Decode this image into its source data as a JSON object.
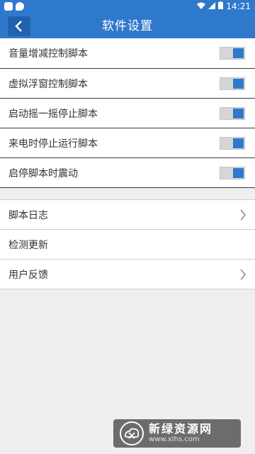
{
  "status_bar": {
    "time": "14:21",
    "icons": [
      "app-icon-1",
      "app-icon-2",
      "wifi-icon",
      "signal-icon",
      "battery-icon"
    ]
  },
  "header": {
    "title": "软件设置",
    "back_icon": "chevron-left-icon"
  },
  "settings": {
    "toggles": [
      {
        "label": "音量增减控制脚本",
        "on": true
      },
      {
        "label": "虚拟浮窗控制脚本",
        "on": true
      },
      {
        "label": "启动摇一摇停止脚本",
        "on": true
      },
      {
        "label": "来电时停止运行脚本",
        "on": true
      },
      {
        "label": "启停脚本时震动",
        "on": true
      }
    ],
    "links": [
      {
        "label": "脚本日志",
        "chevron": true
      },
      {
        "label": "检测更新",
        "chevron": false
      },
      {
        "label": "用户反馈",
        "chevron": true
      }
    ]
  },
  "watermark": {
    "title": "新绿资源网",
    "url": "www.xlhs.com"
  },
  "colors": {
    "primary": "#2f79cd",
    "toggle_track": "#d6d6d6",
    "background": "#efefef"
  }
}
